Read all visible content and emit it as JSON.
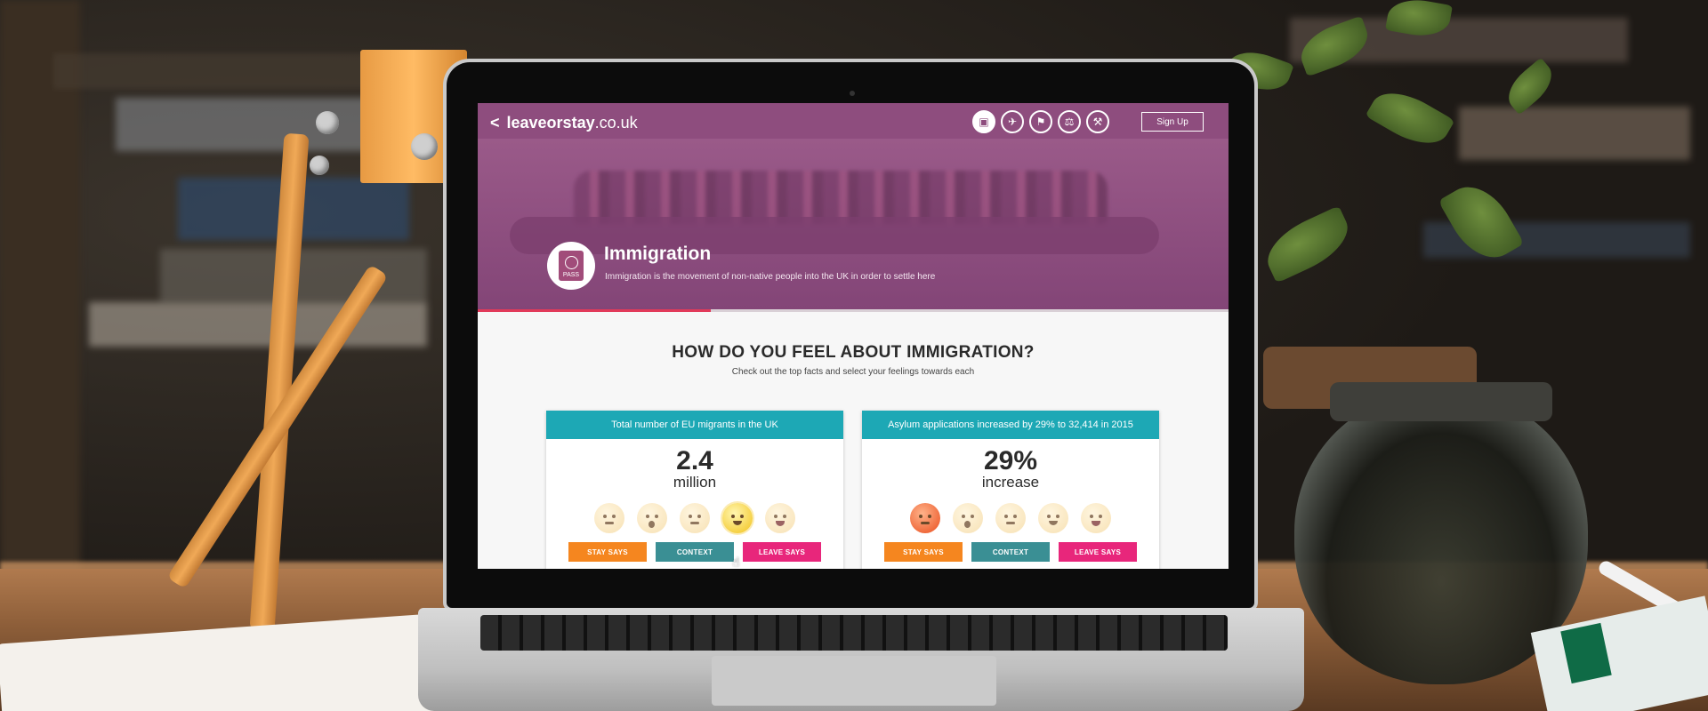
{
  "site": {
    "brand_prefix": "leaveorstay",
    "brand_suffix": ".co.uk",
    "back_glyph": "<",
    "signup_label": "Sign Up",
    "topic_icons": [
      "passport-icon",
      "plane-icon",
      "flag-icon",
      "scales-icon",
      "gavel-icon"
    ],
    "active_topic": "passport-icon"
  },
  "topic": {
    "title": "Immigration",
    "description": "Immigration is the movement of non-native people into the UK in order to settle here",
    "badge_text": "PASS",
    "progress_fraction": 0.31
  },
  "question": {
    "title": "HOW DO YOU FEEL ABOUT IMMIGRATION?",
    "subtitle": "Check out the top facts and select your feelings towards each"
  },
  "cards": [
    {
      "header": "Total number of EU migrants in the UK",
      "value": "2.4",
      "unit": "million",
      "selected_emoji": 3,
      "buttons": {
        "stay": "STAY SAYS",
        "context": "CONTEXT",
        "leave": "LEAVE SAYS"
      }
    },
    {
      "header": "Asylum applications increased by 29% to 32,414 in 2015",
      "value": "29%",
      "unit": "increase",
      "selected_emoji": 0,
      "buttons": {
        "stay": "STAY SAYS",
        "context": "CONTEXT",
        "leave": "LEAVE SAYS"
      }
    }
  ],
  "emoji_names": [
    "angry-face-icon",
    "surprised-face-icon",
    "neutral-face-icon",
    "slight-smile-face-icon",
    "grinning-face-icon"
  ],
  "colors": {
    "hero": "#8e4d7e",
    "card_header": "#1da8b5",
    "stay": "#f5861f",
    "context": "#3a8f94",
    "leave": "#e8267b",
    "progress": "#e23a5a"
  }
}
